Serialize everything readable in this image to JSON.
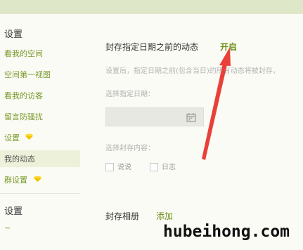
{
  "sidebar": {
    "section1_heading": "设置",
    "items": [
      {
        "label": "看我的空间"
      },
      {
        "label": "空间第一视图"
      },
      {
        "label": "看我的访客"
      },
      {
        "label": "留言防骚扰"
      },
      {
        "label": "设置"
      },
      {
        "label": "我的动态"
      },
      {
        "label": "群设置"
      }
    ],
    "section2_heading": "设置",
    "bottom_item": "~"
  },
  "main": {
    "archive_title": "封存指定日期之前的动态",
    "enable_label": "开启",
    "description": "设置后，指定日期之前(包含当日)的所有动态将被封存，",
    "date_label": "选择指定日期：",
    "content_label": "选择封存内容：",
    "options": [
      {
        "label": "说说"
      },
      {
        "label": "日志"
      }
    ],
    "album_title": "封存相册",
    "album_add": "添加"
  },
  "colors": {
    "accent": "#6b8f1a",
    "sidebar_link": "#7a9a2c",
    "active_bg": "#edf1da",
    "arrow": "#e8413a",
    "diamond": "#f2c400"
  },
  "icons": {
    "calendar": "calendar-icon",
    "diamond": "diamond-icon"
  },
  "watermark": "hubeihong.com"
}
